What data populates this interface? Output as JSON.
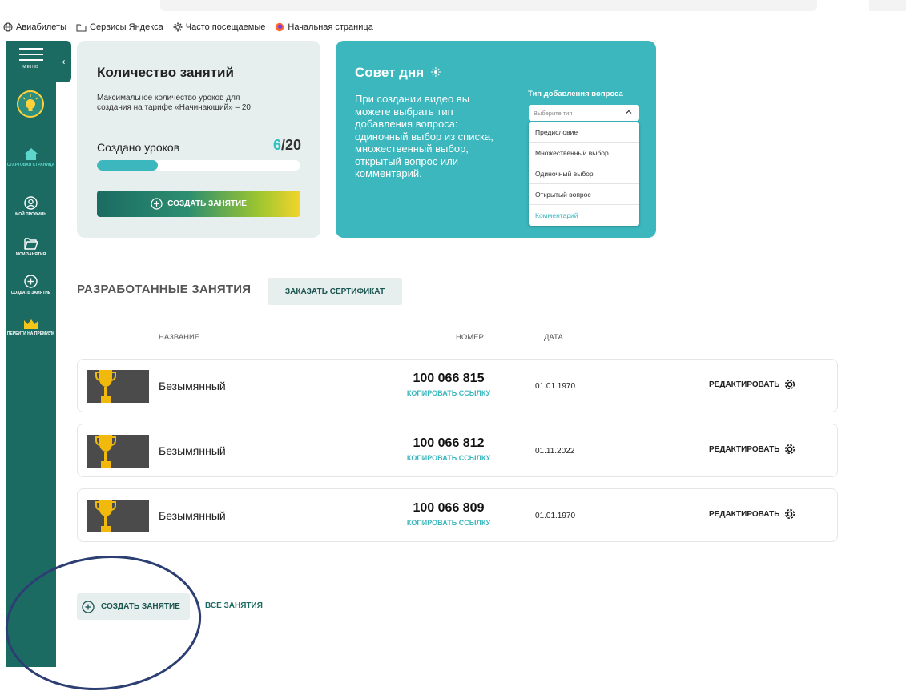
{
  "bookmarks": [
    {
      "icon": "globe-icon",
      "label": "Авиабилеты"
    },
    {
      "icon": "folder-icon",
      "label": "Сервисы Яндекса"
    },
    {
      "icon": "gear-icon",
      "label": "Часто посещаемые"
    },
    {
      "icon": "firefox-icon",
      "label": "Начальная страница"
    }
  ],
  "sidebar": {
    "menu_label": "МЕНЮ",
    "items": [
      {
        "icon": "home-icon",
        "label": "СТАРТОВАЯ СТРАНИЦА",
        "active": true
      },
      {
        "icon": "profile-icon",
        "label": "МОЙ ПРОФИЛЬ"
      },
      {
        "icon": "folder-icon",
        "label": "МОИ ЗАНЯТИЯ"
      },
      {
        "icon": "plus-circle-icon",
        "label": "СОЗДАТЬ ЗАНЯТИЕ"
      },
      {
        "icon": "crown-icon",
        "label": "ПЕРЕЙТИ НА ПРЕМИУМ"
      }
    ],
    "toggle_glyph": "‹"
  },
  "lessons_card": {
    "title": "Количество занятий",
    "description": "Максимальное количество уроков для создания на тарифе «Начинающий» – 20",
    "created_label": "Создано уроков",
    "created_count": "6",
    "max_count": "/20",
    "progress": 0.3,
    "create_button": "СОЗДАТЬ ЗАНЯТИЕ"
  },
  "tip_card": {
    "title": "Совет дня",
    "text": "При создании видео вы можете выбрать тип добавления вопроса: одиночный выбор из списка, множественный выбор, открытый вопрос или комментарий.",
    "dropdown_label": "Тип добавления вопроса",
    "dropdown_placeholder": "Выберите тип",
    "options": [
      "Предисловие",
      "Множественный выбор",
      "Одиночный выбор",
      "Открытый вопрос",
      "Комментарий"
    ]
  },
  "developed": {
    "title": "РАЗРАБОТАННЫЕ ЗАНЯТИЯ",
    "cert_button": "ЗАКАЗАТЬ СЕРТИФИКАТ",
    "columns": {
      "name": "НАЗВАНИЕ",
      "number": "НОМЕР",
      "date": "ДАТА"
    },
    "rows": [
      {
        "name": "Безымянный",
        "number": "100 066 815",
        "copy": "КОПИРОВАТЬ ССЫЛКУ",
        "date": "01.01.1970",
        "edit": "РЕДАКТИРОВАТЬ"
      },
      {
        "name": "Безымянный",
        "number": "100 066 812",
        "copy": "КОПИРОВАТЬ ССЫЛКУ",
        "date": "01.11.2022",
        "edit": "РЕДАКТИРОВАТЬ"
      },
      {
        "name": "Безымянный",
        "number": "100 066 809",
        "copy": "КОПИРОВАТЬ ССЫЛКУ",
        "date": "01.01.1970",
        "edit": "РЕДАКТИРОВАТЬ"
      }
    ]
  },
  "bottom": {
    "create_button": "СОЗДАТЬ ЗАНЯТИЕ",
    "all_link": "ВСЕ ЗАНЯТИЯ"
  },
  "colors": {
    "sidebar": "#1b6b63",
    "accent": "#3bb7bd",
    "card_bg": "#e6eeee",
    "annotation": "#2c3e72"
  }
}
